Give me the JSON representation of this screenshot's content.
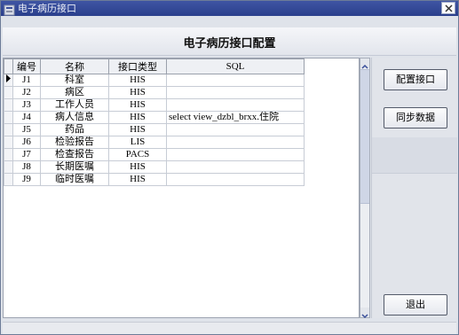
{
  "window": {
    "title": "电子病历接口"
  },
  "header": {
    "title": "电子病历接口配置"
  },
  "table": {
    "columns": [
      "编号",
      "名称",
      "接口类型",
      "SQL"
    ],
    "rows": [
      {
        "code": "J1",
        "name": "科室",
        "type": "HIS",
        "sql": ""
      },
      {
        "code": "J2",
        "name": "病区",
        "type": "HIS",
        "sql": ""
      },
      {
        "code": "J3",
        "name": "工作人员",
        "type": "HIS",
        "sql": ""
      },
      {
        "code": "J4",
        "name": "病人信息",
        "type": "HIS",
        "sql": "select view_dzbl_brxx.住院"
      },
      {
        "code": "J5",
        "name": "药品",
        "type": "HIS",
        "sql": ""
      },
      {
        "code": "J6",
        "name": "检验报告",
        "type": "LIS",
        "sql": ""
      },
      {
        "code": "J7",
        "name": "检查报告",
        "type": "PACS",
        "sql": ""
      },
      {
        "code": "J8",
        "name": "长期医嘱",
        "type": "HIS",
        "sql": ""
      },
      {
        "code": "J9",
        "name": "临时医嘱",
        "type": "HIS",
        "sql": ""
      }
    ],
    "selected_row": 1
  },
  "buttons": {
    "config": "配置接口",
    "sync": "同步数据",
    "exit": "退出"
  },
  "icons": {
    "app": "app-icon",
    "close": "close-icon",
    "row_pointer": "row-pointer-icon",
    "scroll_up": "scroll-up-icon",
    "scroll_down": "scroll-down-icon"
  },
  "colors": {
    "titlebar": "#2f4594",
    "background": "#dfe3ea"
  }
}
